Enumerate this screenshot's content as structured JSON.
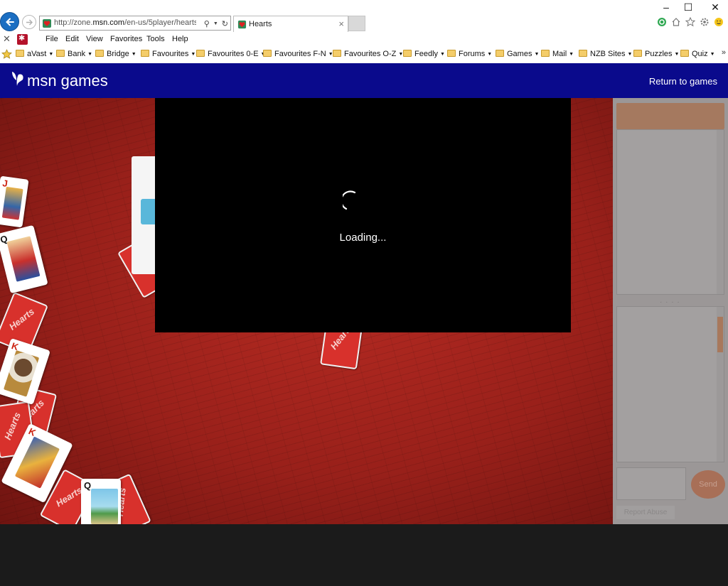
{
  "browser": {
    "url_prefix": "http://zone.",
    "url_domain": "msn.com",
    "url_suffix": "/en-us/5player/hearts/",
    "tab_title": "Hearts",
    "window_controls": [
      "–",
      "☐",
      "✕"
    ]
  },
  "menubar": {
    "close": "✕",
    "items": [
      "File",
      "Edit",
      "View",
      "Favorites",
      "Tools",
      "Help"
    ]
  },
  "favorites": {
    "items": [
      "aVast",
      "Bank",
      "Bridge",
      "Favourites",
      "Favourites 0-E",
      "Favourites F-N",
      "Favourites O-Z",
      "Feedly",
      "Forums",
      "Games",
      "Mail",
      "NZB Sites",
      "Puzzles",
      "Quiz"
    ],
    "more": "»"
  },
  "msn": {
    "logo_text": "msn games",
    "return_link": "Return to games"
  },
  "game": {
    "loading_text": "Loading...",
    "cards": [
      {
        "rank": "J"
      },
      {
        "rank": "Q"
      },
      {
        "rank": "K"
      },
      {
        "rank": "K"
      },
      {
        "rank": "Q"
      }
    ],
    "card_back_text": "Hearts"
  },
  "sidebar": {
    "grip": "· · · ·",
    "send_label": "Send",
    "report_label": "Report Abuse"
  },
  "colors": {
    "msn_blue": "#0a0a8c",
    "felt_red": "#a82620",
    "overlay": "#000000",
    "sidebar_gray": "#9b9797"
  }
}
